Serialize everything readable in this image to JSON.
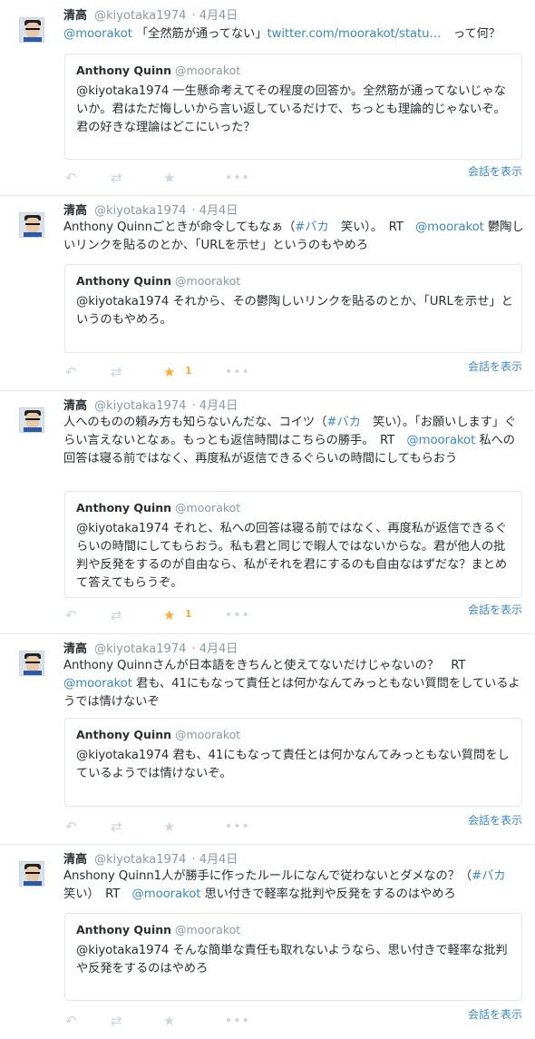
{
  "tweets": [
    {
      "name": "清高",
      "handle": "@kiyotaka1974",
      "date": "· 4月4日",
      "text": [
        {
          "t": "@moorakot",
          "link": true
        },
        {
          "t": " 「全然筋が通ってない」"
        },
        {
          "t": "twitter.com/moorakot/statu…",
          "link": true
        },
        {
          "t": "　って何？"
        }
      ],
      "quote": {
        "name": "Anthony Quinn",
        "handle": "@moorakot",
        "text": "@kiyotaka1974 一生懸命考えてその程度の回答か。全然筋が通ってないじゃないか。君はただ悔しいから言い返しているだけで、ちっとも理論的じゃないぞ。君の好きな理論はどこにいった？"
      },
      "fav_count": "",
      "conversation": "会話を表示"
    },
    {
      "name": "清高",
      "handle": "@kiyotaka1974",
      "date": "· 4月4日",
      "text": [
        {
          "t": "Anthony Quinnごときが命令してもなぁ（"
        },
        {
          "t": "#バカ",
          "link": true
        },
        {
          "t": "　笑い）。　RT　"
        },
        {
          "t": "@moorakot",
          "link": true
        },
        {
          "t": " 鬱陶しいリンクを貼るのとか、「URLを示せ」というのもやめろ"
        }
      ],
      "quote": {
        "name": "Anthony Quinn",
        "handle": "@moorakot",
        "text": "@kiyotaka1974 それから、その鬱陶しいリンクを貼るのとか、「URLを示せ」というのもやめろ。"
      },
      "fav_count": "1",
      "conversation": "会話を表示"
    },
    {
      "name": "清高",
      "handle": "@kiyotaka1974",
      "date": "· 4月4日",
      "text": [
        {
          "t": "人へのものの頼み方も知らないんだな、コイツ（"
        },
        {
          "t": "#バカ",
          "link": true
        },
        {
          "t": "　笑い）。「お願いします」ぐらい言えないとなぁ。もっとも返信時間はこちらの勝手。　RT　"
        },
        {
          "t": "@moorakot",
          "link": true
        },
        {
          "t": " 私への回答は寝る前ではなく、再度私が返信できるぐらいの時間にしてもらおう"
        }
      ],
      "quote": {
        "name": "Anthony Quinn",
        "handle": "@moorakot",
        "text": "@kiyotaka1974 それと、私への回答は寝る前ではなく、再度私が返信できるぐらいの時間にしてもらおう。私も君と同じで暇人ではないからな。君が他人の批判や反発をするのが自由なら、私がそれを君にするのも自由なはずだな？まとめて答えてもらうぞ。"
      },
      "fav_count": "1",
      "conversation": "会話を表示"
    },
    {
      "name": "清高",
      "handle": "@kiyotaka1974",
      "date": "· 4月4日",
      "text": [
        {
          "t": "Anthony Quinnさんが日本語をきちんと使えてないだけじゃないの？　RT　"
        },
        {
          "t": "@moorakot",
          "link": true
        },
        {
          "t": " 君も、41にもなって責任とは何かなんてみっともない質問をしているようでは情けないぞ"
        }
      ],
      "quote": {
        "name": "Anthony Quinn",
        "handle": "@moorakot",
        "text": "@kiyotaka1974 君も、41にもなって責任とは何かなんてみっともない質問をしているようでは情けないぞ。"
      },
      "fav_count": "",
      "conversation": "会話を表示"
    },
    {
      "name": "清高",
      "handle": "@kiyotaka1974",
      "date": "· 4月4日",
      "text": [
        {
          "t": "Anshony Quinn1人が勝手に作ったルールになんで従わないとダメなの？（"
        },
        {
          "t": "#バカ",
          "link": true
        },
        {
          "t": "　笑い）　RT　"
        },
        {
          "t": "@moorakot",
          "link": true
        },
        {
          "t": " 思い付きで軽率な批判や反発をするのはやめろ"
        }
      ],
      "quote": {
        "name": "Anthony Quinn",
        "handle": "@moorakot",
        "text": "@kiyotaka1974 そんな簡単な責任も取れないようなら、思い付きで軽率な批判や反発をするのはやめろ"
      },
      "fav_count": "",
      "conversation": "会話を表示"
    }
  ],
  "icons": {
    "reply": "reply-icon",
    "retweet": "retweet-icon",
    "favorite": "star-icon",
    "more": "more-icon"
  },
  "colors": {
    "link": "#3b88c3",
    "muted": "#8899a6",
    "favorite_active": "#ffac33",
    "icon_inactive": "#ccd6dd"
  }
}
